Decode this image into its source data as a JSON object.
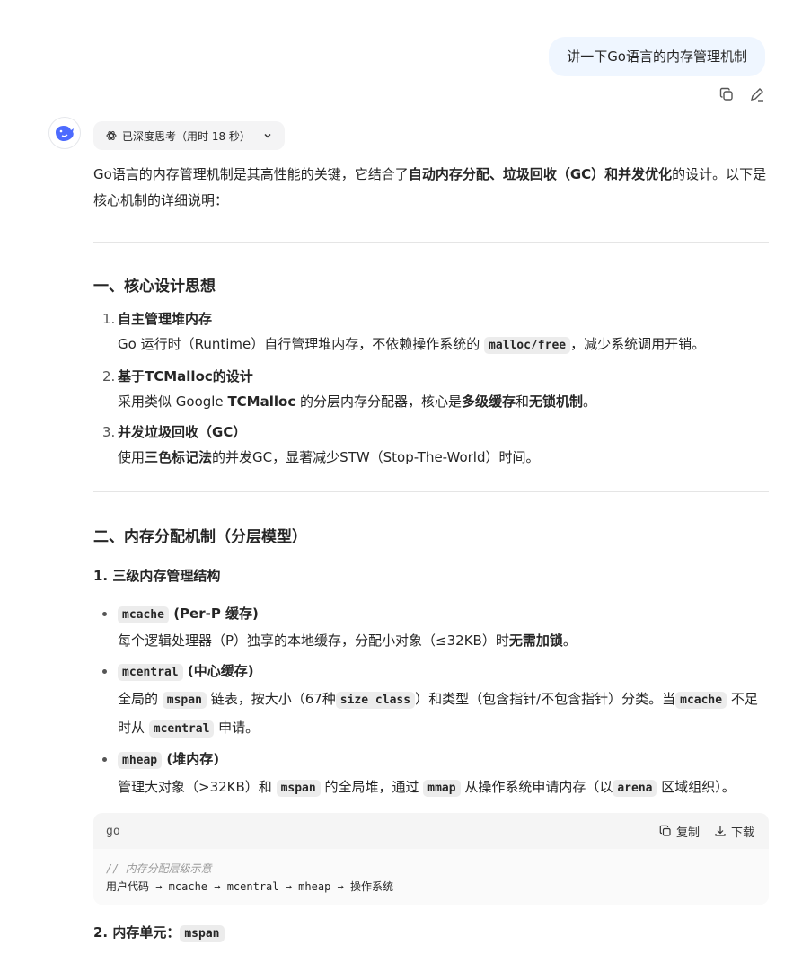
{
  "user_message": "讲一下Go语言的内存管理机制",
  "think_chip": {
    "label": "已深度思考（用时 18 秒）"
  },
  "intro": {
    "part1": "Go语言的内存管理机制是其高性能的关键，它结合了",
    "bold": "自动内存分配、垃圾回收（GC）和并发优化",
    "part2": "的设计。以下是核心机制的详细说明："
  },
  "section1": {
    "title": "一、核心设计思想",
    "items": [
      {
        "num": "1.",
        "title": "自主管理堆内存",
        "desc_a": "Go 运行时（Runtime）自行管理堆内存，不依赖操作系统的 ",
        "code": "malloc/free",
        "desc_b": "，减少系统调用开销。"
      },
      {
        "num": "2.",
        "title": "基于TCMalloc的设计",
        "desc_a": "采用类似 Google ",
        "bold1": "TCMalloc",
        "desc_b": " 的分层内存分配器，核心是",
        "bold2": "多级缓存",
        "desc_c": "和",
        "bold3": "无锁机制",
        "desc_d": "。"
      },
      {
        "num": "3.",
        "title": "并发垃圾回收（GC）",
        "desc_a": "使用",
        "bold1": "三色标记法",
        "desc_b": "的并发GC，显著减少STW（Stop-The-World）时间。"
      }
    ]
  },
  "section2": {
    "title": "二、内存分配机制（分层模型）",
    "sub1": "1. 三级内存管理结构",
    "bullets": [
      {
        "code": "mcache",
        "title": " (Per-P 缓存)",
        "desc_a": "每个逻辑处理器（P）独享的本地缓存，分配小对象（≤32KB）时",
        "bold": "无需加锁",
        "desc_b": "。"
      },
      {
        "code": "mcentral",
        "title": " (中心缓存)",
        "d1": "全局的 ",
        "c1": "mspan",
        "d2": " 链表，按大小（67种",
        "c2": "size class",
        "d3": "）和类型（包含指针/不包含指针）分类。当",
        "c3": "mcache",
        "d4": " 不足时从 ",
        "c4": "mcentral",
        "d5": " 申请。"
      },
      {
        "code": "mheap",
        "title": " (堆内存)",
        "d1": "管理大对象（>32KB）和 ",
        "c1": "mspan",
        "d2": " 的全局堆，通过 ",
        "c2": "mmap",
        "d3": " 从操作系统申请内存（以",
        "c3": "arena",
        "d4": " 区域组织）。"
      }
    ],
    "codeblock": {
      "lang": "go",
      "copy_label": "复制",
      "download_label": "下载",
      "comment": "// 内存分配层级示意",
      "code": "用户代码 → mcache → mcentral → mheap → 操作系统"
    },
    "sub2_prefix": "2. 内存单元：",
    "sub2_code": "mspan"
  }
}
